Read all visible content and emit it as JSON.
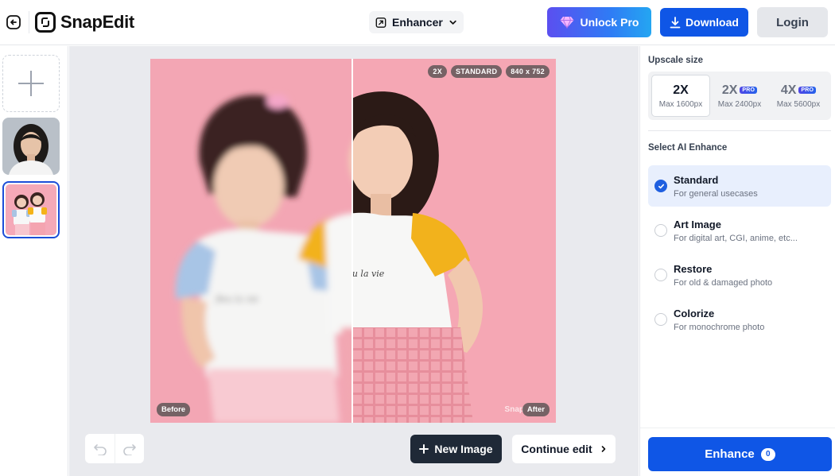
{
  "header": {
    "brand": "SnapEdit",
    "tool_selector": "Enhancer",
    "unlock_label": "Unlock Pro",
    "download_label": "Download",
    "login_label": "Login"
  },
  "canvas": {
    "badges": [
      "2X",
      "STANDARD",
      "840 x 752"
    ],
    "before_label": "Before",
    "after_label": "After",
    "watermark": "Snap",
    "new_image_label": "New Image",
    "continue_label": "Continue edit"
  },
  "panel": {
    "upscale_title": "Upscale size",
    "sizes": [
      {
        "label": "2X",
        "sub": "Max 1600px",
        "pro": false,
        "selected": true
      },
      {
        "label": "2X",
        "sub": "Max 2400px",
        "pro": true,
        "selected": false
      },
      {
        "label": "4X",
        "sub": "Max 5600px",
        "pro": true,
        "selected": false
      }
    ],
    "pro_tag": "PRO",
    "ai_title": "Select AI Enhance",
    "options": [
      {
        "title": "Standard",
        "sub": "For general usecases",
        "selected": true
      },
      {
        "title": "Art Image",
        "sub": "For digital art, CGI, anime, etc...",
        "selected": false
      },
      {
        "title": "Restore",
        "sub": "For old & damaged photo",
        "selected": false
      },
      {
        "title": "Colorize",
        "sub": "For monochrome photo",
        "selected": false
      }
    ],
    "enhance_label": "Enhance",
    "enhance_count": "0"
  },
  "colors": {
    "primary": "#0f56e6",
    "selected_option_bg": "#e8effd",
    "canvas_bg": "#e9eaee"
  }
}
